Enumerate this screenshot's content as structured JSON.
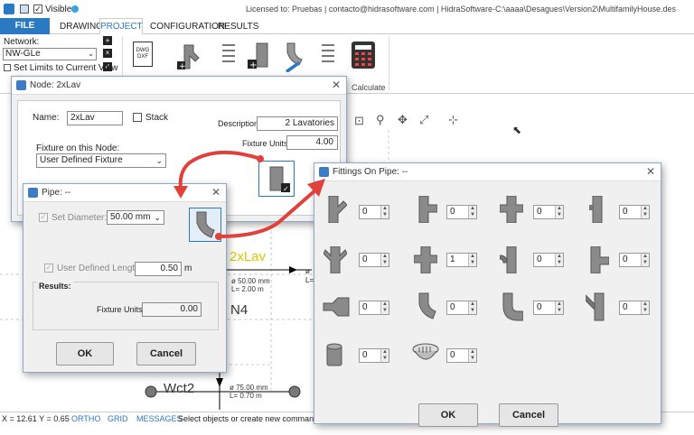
{
  "titlebar": {
    "visible_label": "Visible",
    "license": "Licensed to: Pruebas | contacto@hidrasoftware.com | HidraSoftware-C:\\aaaa\\Desagues\\Version2\\MultifamilyHouse.des"
  },
  "ribbon": {
    "tabs": [
      "FILE",
      "DRAWING",
      "PROJECT",
      "CONFIGURATION",
      "RESULTS"
    ],
    "active_tab": "PROJECT",
    "network_label": "Network:",
    "network_value": "NW-GLe",
    "set_limits": "Set Limits to Current View",
    "calculate": "Calculate",
    "dwg_label": "DWG DXF"
  },
  "canvas": {
    "label_2xlav": "2xLav",
    "label_n4": "N4",
    "label_wct2": "Wct2",
    "pipe_a_diam": "ø 50.00 mm",
    "pipe_a_len": "L= 2.00 m",
    "pipe_b_diam": "ø 75.00 mm",
    "pipe_b_len": "L= 0.70 m",
    "frag_1": "ø",
    "frag_2": "L="
  },
  "statusbar": {
    "coords": "X = 12.61  Y = 0.65",
    "ortho": "ORTHO",
    "grid": "GRID",
    "messages": "MESSAGES",
    "hint": "Select objects or create new command"
  },
  "node_dialog": {
    "title": "Node: 2xLav",
    "name_label": "Name:",
    "name_value": "2xLav",
    "stack_label": "Stack",
    "fixture_label": "Fixture on this Node:",
    "fixture_value": "User Defined Fixture",
    "description_label": "Description:",
    "description_value": "2 Lavatories",
    "fixture_units_label": "Fixture Units:",
    "fixture_units_value": "4.00"
  },
  "pipe_dialog": {
    "title": "Pipe: --",
    "set_diameter_label": "Set Diameter:",
    "diameter_value": "50.00 mm",
    "user_length_label": "User Defined Length:",
    "length_value": "0.50",
    "length_unit": "m",
    "results_label": "Results:",
    "fixture_units_label": "Fixture Units:",
    "fixture_units_value": "0.00",
    "ok": "OK",
    "cancel": "Cancel"
  },
  "fittings_dialog": {
    "title": "Fittings On Pipe: --",
    "rows": [
      [
        "0",
        "0",
        "0",
        "0"
      ],
      [
        "0",
        "1",
        "0",
        "0"
      ],
      [
        "0",
        "0",
        "0",
        "0"
      ],
      [
        "0",
        "0"
      ]
    ],
    "ok": "OK",
    "cancel": "Cancel"
  },
  "colors": {
    "accent": "#2b79c2",
    "arrow": "#e0413a",
    "label_yellow": "#d8c800"
  }
}
